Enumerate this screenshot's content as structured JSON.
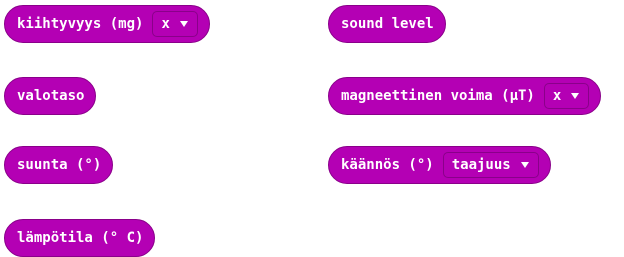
{
  "blocks": {
    "acceleration": {
      "label": "kiihtyvyys (mg)",
      "dropdown_value": "x"
    },
    "sound_level": {
      "label": "sound level"
    },
    "light_level": {
      "label": "valotaso"
    },
    "magnetic_force": {
      "label": "magneettinen voima (μT)",
      "dropdown_value": "x"
    },
    "compass_heading": {
      "label": "suunta (°)"
    },
    "rotation": {
      "label": "käännös (°)",
      "dropdown_value": "taajuus"
    },
    "temperature": {
      "label": "lämpötila (° C)"
    }
  },
  "colors": {
    "block_fill": "#b400b4",
    "block_border": "#8a008a",
    "text": "#ffffff"
  },
  "icons": {
    "dropdown_caret": "caret-down-icon"
  }
}
